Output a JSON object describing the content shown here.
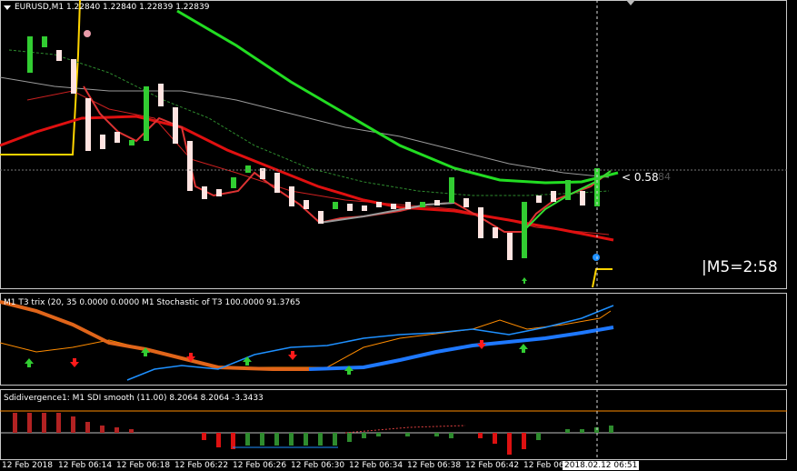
{
  "main": {
    "symbol_label": "EURUSD,M1  1.22840 1.22840 1.22839 1.22839",
    "price_marker": "< 0.58",
    "price_marker_ghost": "84",
    "timer_label": "|M5=2:58"
  },
  "ind1": {
    "label": "M1 T3 trix (20, 35 0.0000 0.0000  M1   Stochastic of T3 100.0000 91.3765"
  },
  "ind2": {
    "label": "Sdidivergence1:  M1   SDI smooth (11.00) 8.2064 8.2064 -3.3433"
  },
  "time_axis": {
    "labels": [
      "12 Feb 2018",
      "12 Feb 06:14",
      "12 Feb 06:18",
      "12 Feb 06:22",
      "12 Feb 06:26",
      "12 Feb 06:30",
      "12 Feb 06:34",
      "12 Feb 06:38",
      "12 Feb 06:42",
      "12 Feb 06"
    ],
    "cursor_time": "2018.02.12 06:51"
  },
  "colors": {
    "bull_candle": "#32cd32",
    "bear_candle": "#ffe4e1",
    "ma_red": "#ff0000",
    "ma_green": "#32cd32",
    "trix_blue": "#1e90ff",
    "trix_orange": "#ff8c00",
    "hist_red": "#ff0000",
    "hist_green": "#32cd32"
  }
}
